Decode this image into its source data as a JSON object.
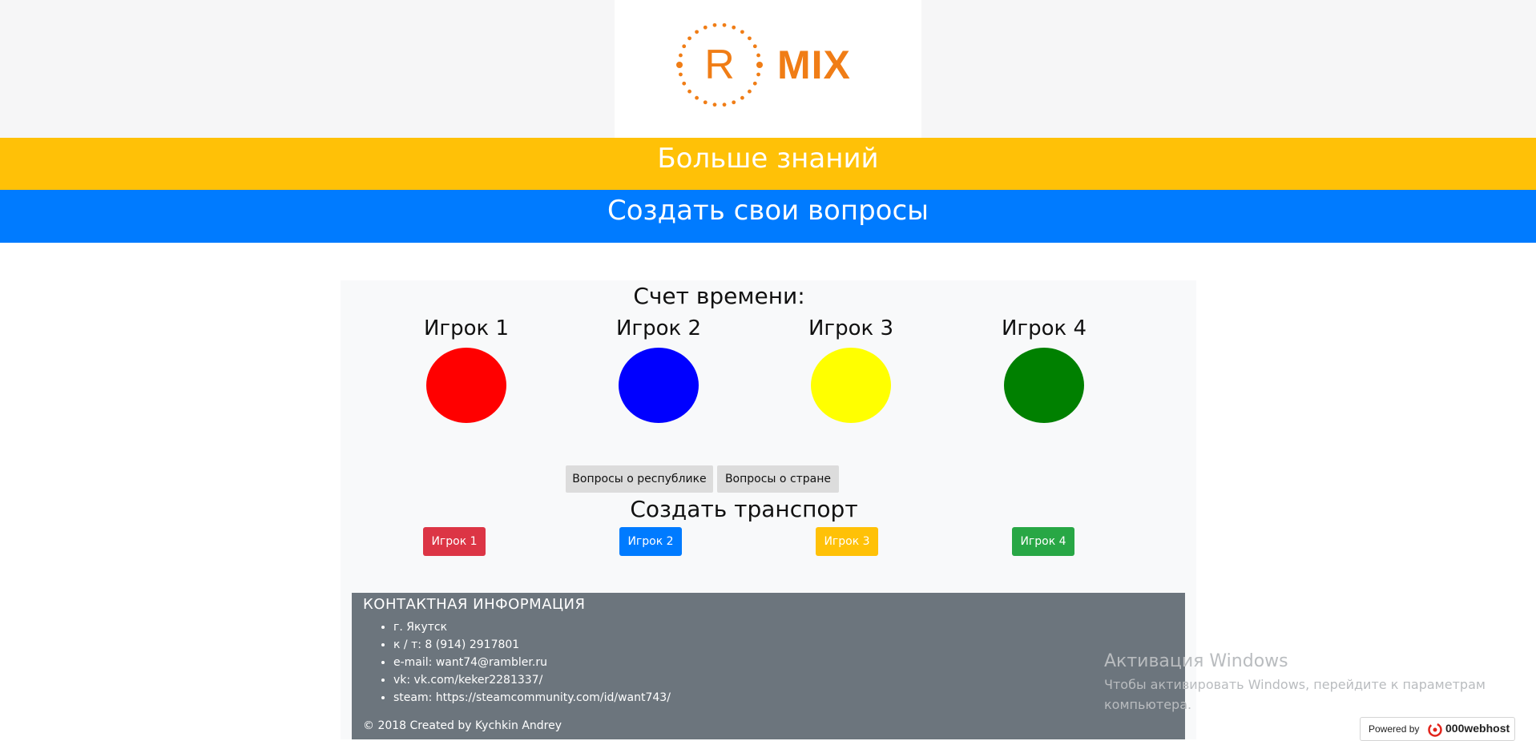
{
  "header": {
    "logo_letter": "R",
    "logo_word": "MIX",
    "nav": [
      {
        "label": "Больше знаний"
      },
      {
        "label": "Создать свои вопросы"
      }
    ]
  },
  "score": {
    "title": "Счет времени:",
    "players": [
      {
        "name": "Игрок 1",
        "color": "#ff0000"
      },
      {
        "name": "Игрок 2",
        "color": "#0000ff"
      },
      {
        "name": "Игрок 3",
        "color": "#ffff00"
      },
      {
        "name": "Игрок 4",
        "color": "#008000"
      }
    ]
  },
  "questions": {
    "buttons": [
      "Вопросы о республике",
      "Вопросы о стране"
    ]
  },
  "transport": {
    "title": "Создать транспорт",
    "buttons": [
      {
        "label": "Игрок 1",
        "color": "#dc3545"
      },
      {
        "label": "Игрок 2",
        "color": "#007bff"
      },
      {
        "label": "Игрок 3",
        "color": "#ffc107"
      },
      {
        "label": "Игрок 4",
        "color": "#28a745"
      }
    ]
  },
  "footer": {
    "title": "КОНТАКТНАЯ ИНФОРМАЦИЯ",
    "items": [
      "г. Якутск",
      "к / т: 8 (914) 2917801",
      "e-mail: want74@rambler.ru",
      "vk: vk.com/keker2281337/",
      "steam: https://steamcommunity.com/id/want743/"
    ],
    "copyright": "© 2018 Created by Kychkin Andrey"
  },
  "windows_activation": {
    "title": "Активация Windows",
    "text": "Чтобы активировать Windows, перейдите к параметрам компьютера."
  },
  "badge": {
    "powered_by": "Powered by",
    "brand": "000webhost"
  },
  "colors": {
    "brand_orange": "#f07d16",
    "nav_yellow": "#ffc107",
    "nav_blue": "#007bff",
    "footer_gray": "#6c757d"
  }
}
